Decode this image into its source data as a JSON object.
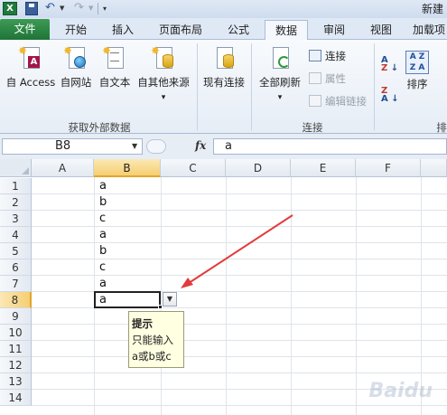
{
  "window": {
    "title": "新建"
  },
  "tabs": {
    "file": "文件",
    "items": [
      "开始",
      "插入",
      "页面布局",
      "公式",
      "数据",
      "审阅",
      "视图",
      "加载项"
    ],
    "active_index": 4
  },
  "ribbon": {
    "get_external": {
      "access": "自 Access",
      "web": "自网站",
      "text": "自文本",
      "other": "自其他来源",
      "other_arrow": "▾",
      "label": "获取外部数据"
    },
    "existing": "现有连接",
    "connections": {
      "refresh_all": "全部刷新",
      "refresh_arrow": "▾",
      "connections": "连接",
      "properties": "属性",
      "edit_links": "编辑链接",
      "label": "连接"
    },
    "sort": {
      "sort": "排序",
      "group_label_partial": "排"
    }
  },
  "formula_bar": {
    "name_box": "B8",
    "fx": "fx",
    "value": "a"
  },
  "grid": {
    "columns": [
      "A",
      "B",
      "C",
      "D",
      "E",
      "F"
    ],
    "selected_column": "B",
    "rows": [
      "1",
      "2",
      "3",
      "4",
      "5",
      "6",
      "7",
      "8",
      "9",
      "10",
      "11",
      "12",
      "13",
      "14"
    ],
    "selected_row": "8",
    "column_b_values": [
      "a",
      "b",
      "c",
      "a",
      "b",
      "c",
      "a",
      "a"
    ]
  },
  "validation_tip": {
    "title": "提示",
    "line1": "只能输入",
    "line2": "a或b或c"
  },
  "watermark": "Baidu"
}
